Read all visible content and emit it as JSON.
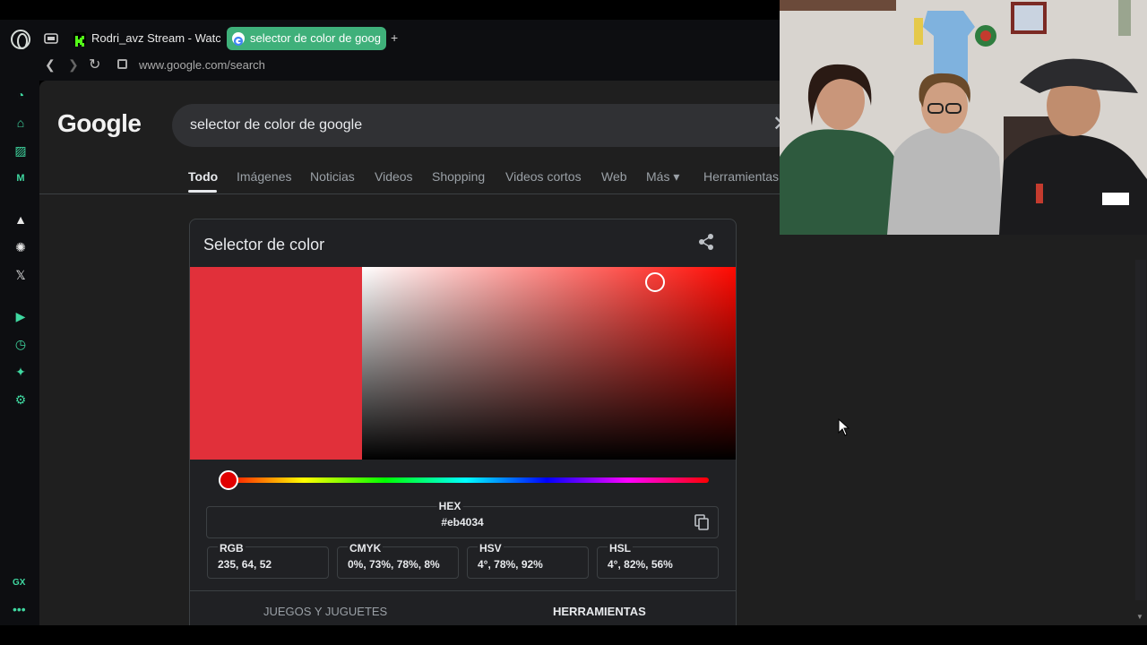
{
  "browser": {
    "tabs": [
      {
        "label": "Rodri_avz Stream - Watch",
        "favicon": "kick-icon",
        "active": false
      },
      {
        "label": "selector de color de goog",
        "favicon": "google-icon",
        "active": true
      }
    ],
    "new_tab": "+",
    "url": "www.google.com/search"
  },
  "google": {
    "logo": "Google",
    "query": "selector de color de google",
    "tabs": [
      "Todo",
      "Imágenes",
      "Noticias",
      "Videos",
      "Shopping",
      "Videos cortos",
      "Web",
      "Más ▾",
      "Herramientas"
    ],
    "active_tab": "Todo"
  },
  "color_picker": {
    "title": "Selector de color",
    "hex_label": "HEX",
    "hex": "#eb4034",
    "rgb_label": "RGB",
    "rgb": "235, 64, 52",
    "cmyk_label": "CMYK",
    "cmyk": "0%, 73%, 78%, 8%",
    "hsv_label": "HSV",
    "hsv": "4°, 78%, 92%",
    "hsl_label": "HSL",
    "hsl": "4°, 82%, 56%",
    "hue_deg": 4,
    "saturation": 0.78,
    "value": 0.92,
    "swatch_color": "#e1303a",
    "knob_color": "#e00000"
  },
  "categories": {
    "left": "JUEGOS Y JUGUETES",
    "right": "HERRAMIENTAS"
  },
  "colors": {
    "accent": "#3fd7a0",
    "active_tab": "#3fb07a",
    "page_bg": "#1f1f1f"
  }
}
